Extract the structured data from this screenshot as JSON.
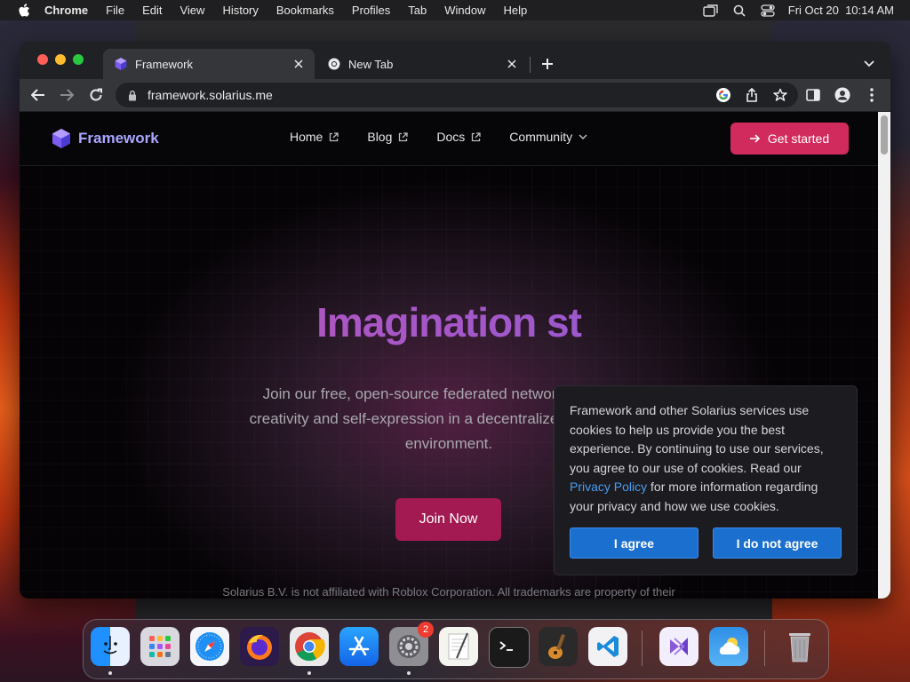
{
  "menubar": {
    "app_name": "Chrome",
    "items": [
      "File",
      "Edit",
      "View",
      "History",
      "Bookmarks",
      "Profiles",
      "Tab",
      "Window",
      "Help"
    ],
    "datetime": "Fri Oct 20  10:14 AM"
  },
  "browser": {
    "tabs": [
      {
        "title": "Framework",
        "active": true
      },
      {
        "title": "New Tab",
        "active": false
      }
    ],
    "url": "framework.solarius.me"
  },
  "site": {
    "brand": "Framework",
    "nav": [
      {
        "label": "Home",
        "icon": "external-link-icon"
      },
      {
        "label": "Blog",
        "icon": "external-link-icon"
      },
      {
        "label": "Docs",
        "icon": "external-link-icon"
      },
      {
        "label": "Community",
        "icon": "chevron-down-icon"
      }
    ],
    "cta_label": "Get started",
    "hero_title": "Imagination st",
    "hero_sub_lines": [
      "Join our free, open-source federated network to explore",
      "creativity and self-expression in a decentralized, censorship",
      "environment."
    ],
    "join_label": "Join Now",
    "disclaimer": "Solarius B.V. is not affiliated with Roblox Corporation. All trademarks are property of their"
  },
  "cookie": {
    "text_before": "Framework and other Solarius services use cookies to help us provide you the best experience. By continuing to use our services, you agree to our use of cookies. Read our ",
    "link_label": "Privacy Policy",
    "text_after": " for more information regarding your privacy and how we use cookies.",
    "agree_label": "I agree",
    "disagree_label": "I do not agree"
  },
  "dock": {
    "apps": [
      {
        "name": "Finder"
      },
      {
        "name": "Launchpad"
      },
      {
        "name": "Safari"
      },
      {
        "name": "Firefox"
      },
      {
        "name": "Chrome"
      },
      {
        "name": "App Store"
      },
      {
        "name": "System Settings",
        "badge": "2"
      },
      {
        "name": "TextEdit"
      },
      {
        "name": "Terminal"
      },
      {
        "name": "GarageBand"
      },
      {
        "name": "Visual Studio Code"
      },
      {
        "name": "Visual Studio"
      },
      {
        "name": "Weather"
      },
      {
        "name": "Trash"
      }
    ]
  },
  "colors": {
    "accent": "#d12a5d",
    "join": "#a31a52",
    "brand_text": "#a8a6ff",
    "cookie_button": "#1a6fcf",
    "link": "#4a9df0"
  }
}
